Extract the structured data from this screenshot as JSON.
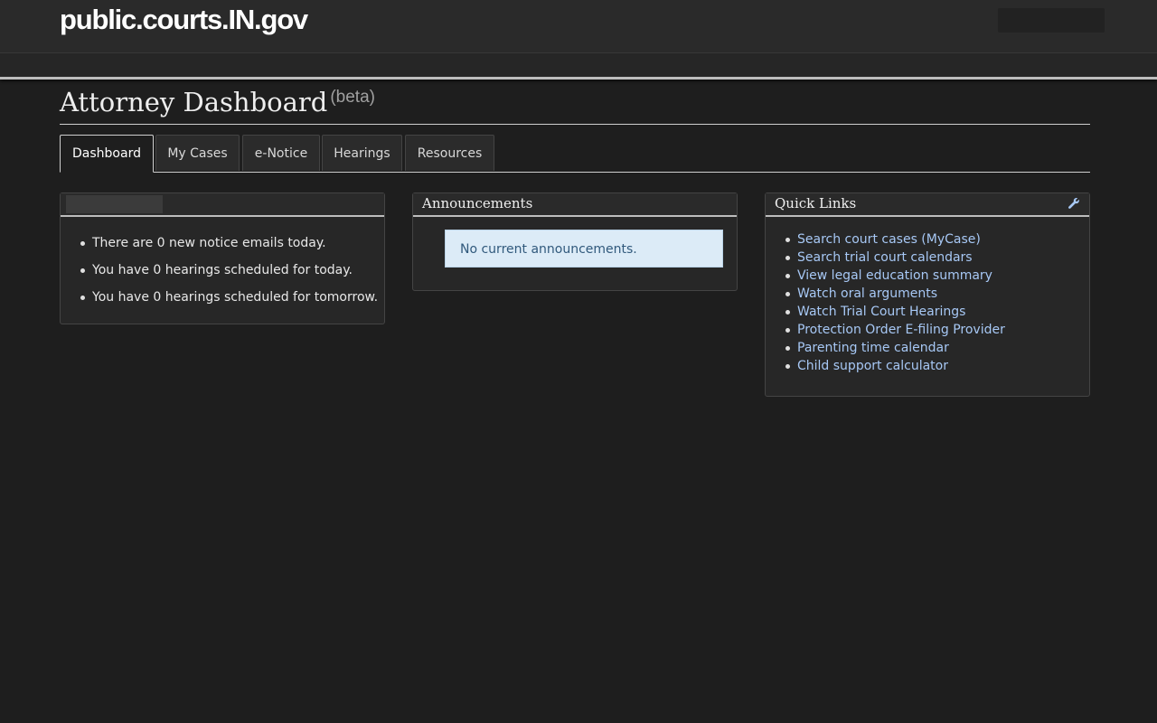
{
  "header": {
    "logo_text": "public.courts.IN.gov"
  },
  "page": {
    "title": "Attorney Dashboard",
    "title_suffix": "(beta)"
  },
  "tabs": [
    {
      "label": "Dashboard",
      "active": true
    },
    {
      "label": "My Cases",
      "active": false
    },
    {
      "label": "e-Notice",
      "active": false
    },
    {
      "label": "Hearings",
      "active": false
    },
    {
      "label": "Resources",
      "active": false
    }
  ],
  "status_panel": {
    "items": [
      "There are 0 new notice emails today.",
      "You have 0 hearings scheduled for today.",
      "You have 0 hearings scheduled for tomorrow."
    ]
  },
  "announcements": {
    "title": "Announcements",
    "message": "No current announcements."
  },
  "quick_links": {
    "title": "Quick Links",
    "icon": "wrench-icon",
    "items": [
      "Search court cases (MyCase)",
      "Search trial court calendars",
      "View legal education summary",
      "Watch oral arguments",
      "Watch Trial Court Hearings",
      "Protection Order E-filing Provider",
      "Parenting time calendar",
      "Child support calculator"
    ]
  },
  "colors": {
    "background": "#1e1e1e",
    "link": "#a7c8f5",
    "announcement_bg": "#dcebf7",
    "announcement_text": "#31597c"
  }
}
